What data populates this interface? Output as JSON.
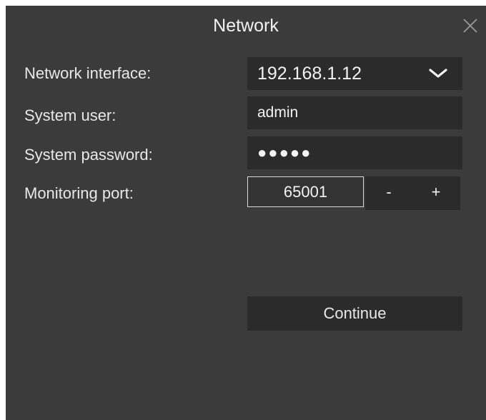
{
  "dialog": {
    "title": "Network",
    "close_icon": "close-icon"
  },
  "form": {
    "network_interface": {
      "label": "Network interface:",
      "value": "192.168.1.12",
      "icon": "chevron-down-icon"
    },
    "system_user": {
      "label": "System user:",
      "value": "admin"
    },
    "system_password": {
      "label": "System password:",
      "value": "●●●●●"
    },
    "monitoring_port": {
      "label": "Monitoring port:",
      "value": "65001",
      "decrement_label": "-",
      "increment_label": "+"
    }
  },
  "actions": {
    "continue_label": "Continue"
  },
  "colors": {
    "dialog_background": "#3b3b3b",
    "field_background": "#2b2b2b",
    "text": "#e8e8e8"
  }
}
